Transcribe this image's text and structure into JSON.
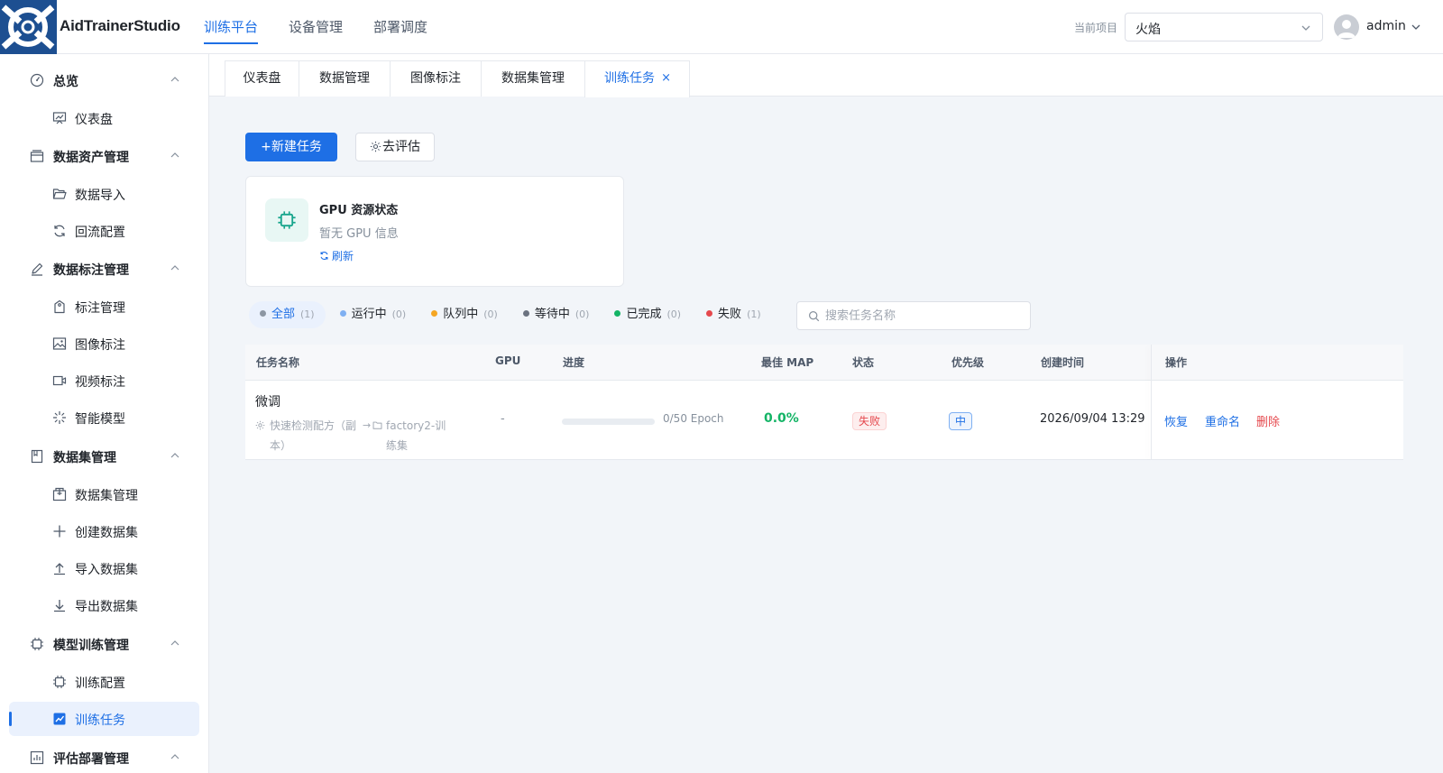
{
  "header": {
    "brand": "AidTrainerStudio",
    "nav": [
      {
        "label": "训练平台",
        "active": true
      },
      {
        "label": "设备管理",
        "active": false
      },
      {
        "label": "部署调度",
        "active": false
      }
    ],
    "project_label": "当前项目",
    "project_value": "火焰",
    "user": "admin"
  },
  "sidebar": {
    "groups": [
      {
        "label": "总览",
        "icon": "gauge-icon",
        "items": [
          {
            "label": "仪表盘",
            "icon": "presentation-chart-icon"
          }
        ]
      },
      {
        "label": "数据资产管理",
        "icon": "storage-box-icon",
        "items": [
          {
            "label": "数据导入",
            "icon": "folder-open-icon"
          },
          {
            "label": "回流配置",
            "icon": "refresh-icon"
          }
        ]
      },
      {
        "label": "数据标注管理",
        "icon": "pen-icon",
        "items": [
          {
            "label": "标注管理",
            "icon": "tag-icon"
          },
          {
            "label": "图像标注",
            "icon": "image-icon"
          },
          {
            "label": "视频标注",
            "icon": "video-icon"
          },
          {
            "label": "智能模型",
            "icon": "sparkle-icon"
          }
        ]
      },
      {
        "label": "数据集管理",
        "icon": "book-icon",
        "items": [
          {
            "label": "数据集管理",
            "icon": "package-icon"
          },
          {
            "label": "创建数据集",
            "icon": "plus-icon"
          },
          {
            "label": "导入数据集",
            "icon": "upload-icon"
          },
          {
            "label": "导出数据集",
            "icon": "download-icon"
          }
        ]
      },
      {
        "label": "模型训练管理",
        "icon": "chip-icon",
        "items": [
          {
            "label": "训练配置",
            "icon": "chip-icon"
          },
          {
            "label": "训练任务",
            "icon": "line-chart-icon",
            "active": true
          }
        ]
      },
      {
        "label": "评估部署管理",
        "icon": "deploy-icon",
        "items": []
      }
    ]
  },
  "tabs": [
    {
      "label": "仪表盘"
    },
    {
      "label": "数据管理"
    },
    {
      "label": "图像标注"
    },
    {
      "label": "数据集管理"
    },
    {
      "label": "训练任务",
      "active": true,
      "closable": true,
      "close_glyph": "×"
    }
  ],
  "toolbar": {
    "new_task_label": "+新建任务",
    "evaluate_label": "去评估"
  },
  "gpu_card": {
    "title": "GPU 资源状态",
    "subtitle": "暂无 GPU 信息",
    "refresh_label": "刷新"
  },
  "filters": [
    {
      "label": "全部",
      "count": "(1)",
      "color": "#8c96a3",
      "active": true
    },
    {
      "label": "运行中",
      "count": "(0)",
      "color": "#7fb0f2"
    },
    {
      "label": "队列中",
      "count": "(0)",
      "color": "#f5a623"
    },
    {
      "label": "等待中",
      "count": "(0)",
      "color": "#6b7280"
    },
    {
      "label": "已完成",
      "count": "(0)",
      "color": "#14b466"
    },
    {
      "label": "失败",
      "count": "(1)",
      "color": "#e5484d"
    }
  ],
  "search": {
    "placeholder": "搜索任务名称"
  },
  "table": {
    "columns": [
      "任务名称",
      "GPU",
      "进度",
      "最佳 MAP",
      "状态",
      "优先级",
      "创建时间",
      "操作"
    ],
    "rows": [
      {
        "name": "微调",
        "recipe": "快速检测配方（副本）",
        "arrow": "→",
        "dataset": "factory2-训练集",
        "gpu": "-",
        "progress_text": "0/50 Epoch",
        "progress_fraction": 0,
        "best_map": "0.0%",
        "status": "失败",
        "priority": "中",
        "created": "2026/09/04 13:29",
        "actions": {
          "resume": "恢复",
          "rename": "重命名",
          "delete": "删除"
        }
      }
    ]
  },
  "colors": {
    "accent": "#1e6fe5",
    "success": "#14b466",
    "danger": "#e5484d"
  }
}
